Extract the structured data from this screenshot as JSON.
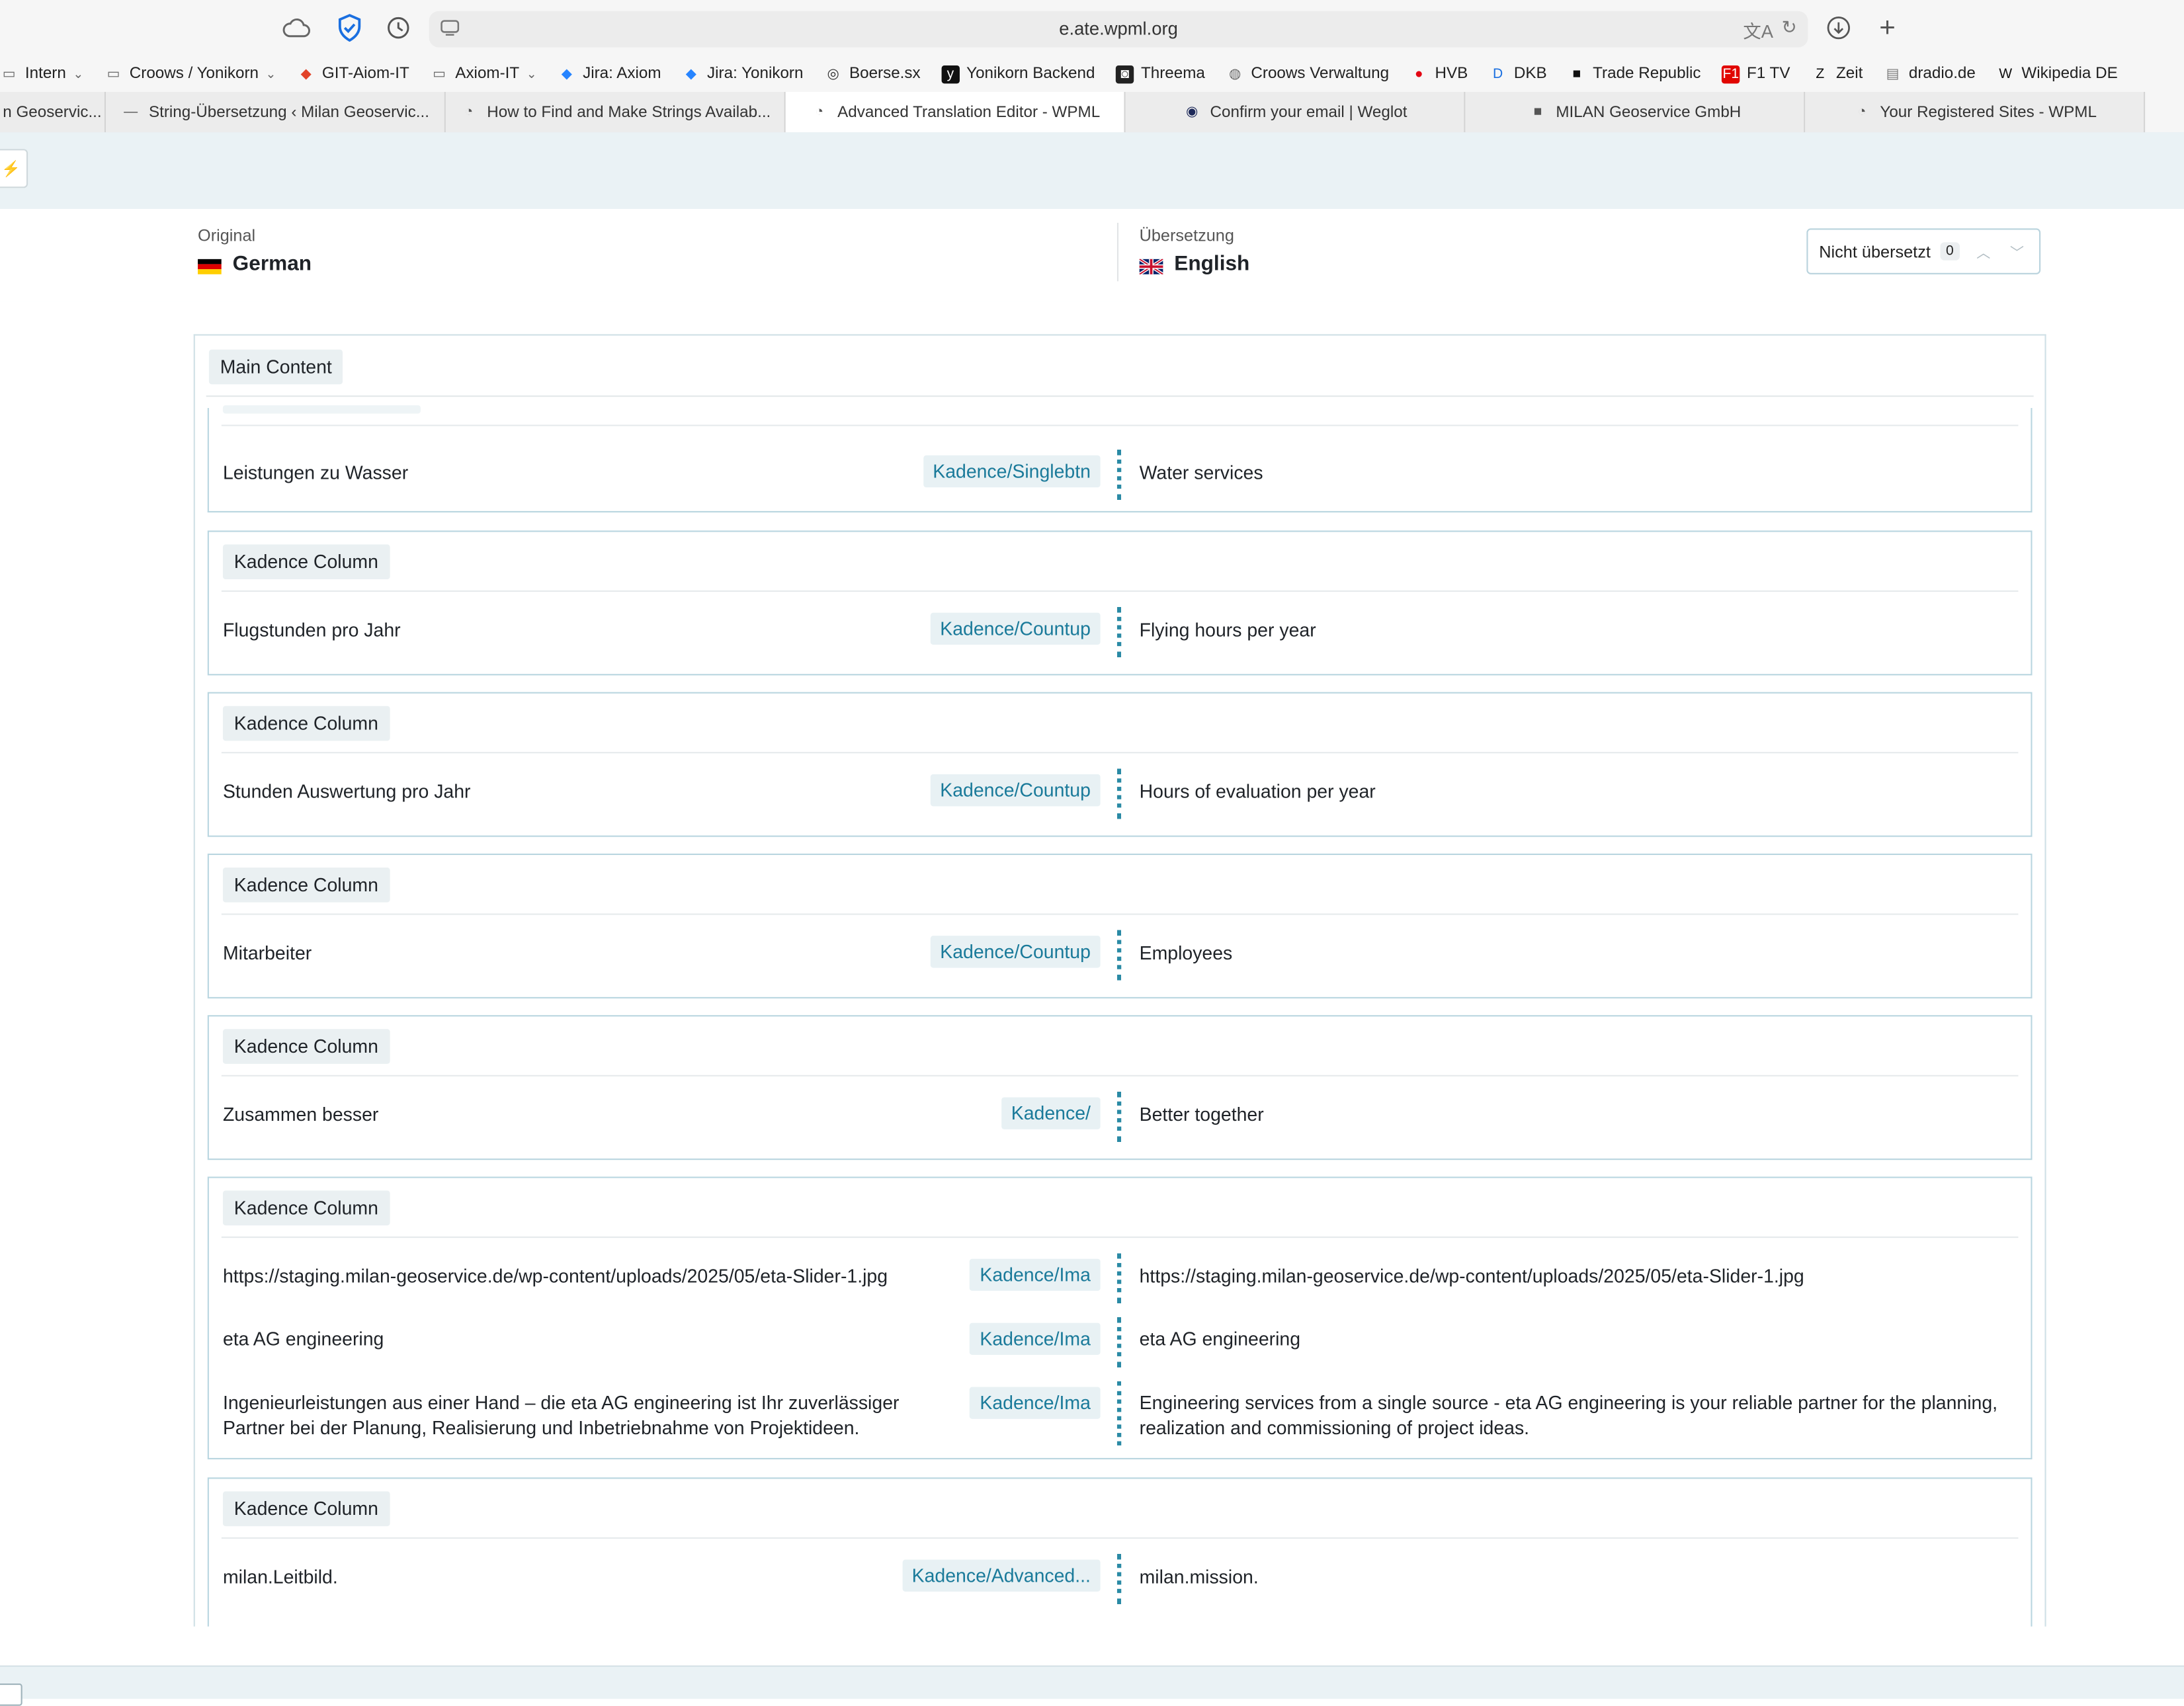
{
  "browser": {
    "url": "e.ate.wpml.org",
    "bookmarks": [
      {
        "label": "Intern",
        "icon": "folder-icon",
        "dropdown": true
      },
      {
        "label": "Croows / Yonikorn",
        "icon": "folder-icon",
        "dropdown": true
      },
      {
        "label": "GIT-Aiom-IT",
        "icon": "gitlab-icon",
        "dropdown": false
      },
      {
        "label": "Axiom-IT",
        "icon": "folder-icon",
        "dropdown": true
      },
      {
        "label": "Jira: Axiom",
        "icon": "jira-icon",
        "dropdown": false
      },
      {
        "label": "Jira: Yonikorn",
        "icon": "jira-icon",
        "dropdown": false
      },
      {
        "label": "Boerse.sx",
        "icon": "boerse-icon",
        "dropdown": false
      },
      {
        "label": "Yonikorn Backend",
        "icon": "yonikorn-icon",
        "dropdown": false
      },
      {
        "label": "Threema",
        "icon": "threema-icon",
        "dropdown": false
      },
      {
        "label": "Croows Verwaltung",
        "icon": "globe-icon",
        "dropdown": false
      },
      {
        "label": "HVB",
        "icon": "hvb-icon",
        "dropdown": false
      },
      {
        "label": "DKB",
        "icon": "dkb-icon",
        "dropdown": false
      },
      {
        "label": "Trade Republic",
        "icon": "trade-republic-icon",
        "dropdown": false
      },
      {
        "label": "F1 TV",
        "icon": "f1-icon",
        "dropdown": false
      },
      {
        "label": "Zeit",
        "icon": "zeit-icon",
        "dropdown": false
      },
      {
        "label": "dradio.de",
        "icon": "dradio-icon",
        "dropdown": false
      },
      {
        "label": "Wikipedia DE",
        "icon": "wikipedia-icon",
        "dropdown": false
      }
    ],
    "tabs": [
      {
        "label": "n Geoservic...",
        "active": false
      },
      {
        "label": "String-Übersetzung ‹ Milan Geoservic...",
        "active": false
      },
      {
        "label": "How to Find and Make Strings Availab...",
        "active": false
      },
      {
        "label": "Advanced Translation Editor - WPML",
        "active": true
      },
      {
        "label": "Confirm your email | Weglot",
        "active": false
      },
      {
        "label": "MILAN Geoservice GmbH",
        "active": false
      },
      {
        "label": "Your Registered Sites - WPML",
        "active": false
      }
    ]
  },
  "editor": {
    "original_label": "Original",
    "original_language": "German",
    "translation_label": "Übersetzung",
    "translation_language": "English",
    "filter_label": "Nicht übersetzt",
    "filter_count": "0"
  },
  "main_section_label": "Main Content",
  "colors": {
    "accent": "#1a7a9a",
    "dots": "#2a8aa5",
    "card_border": "#b9d6e0"
  },
  "sections": [
    {
      "label": "",
      "rows": [
        {
          "source": "Leistungen zu Wasser",
          "tag": "Kadence/Singlebtn",
          "target": "Water services"
        }
      ]
    },
    {
      "label": "Kadence Column",
      "rows": [
        {
          "source": "Flugstunden pro Jahr",
          "tag": "Kadence/Countup",
          "target": "Flying hours per year"
        }
      ]
    },
    {
      "label": "Kadence Column",
      "rows": [
        {
          "source": "Stunden Auswertung pro Jahr",
          "tag": "Kadence/Countup",
          "target": "Hours of evaluation per year"
        }
      ]
    },
    {
      "label": "Kadence Column",
      "rows": [
        {
          "source": "Mitarbeiter",
          "tag": "Kadence/Countup",
          "target": "Employees"
        }
      ]
    },
    {
      "label": "Kadence Column",
      "rows": [
        {
          "source": "Zusammen besser",
          "tag": "Kadence/",
          "target": "Better together"
        }
      ]
    },
    {
      "label": "Kadence Column",
      "rows": [
        {
          "source": "https://staging.milan-geoservice.de/wp-content/uploads/2025/05/eta-Slider-1.jpg",
          "tag": "Kadence/Ima",
          "target": "https://staging.milan-geoservice.de/wp-content/uploads/2025/05/eta-Slider-1.jpg"
        },
        {
          "source": "eta AG engineering",
          "tag": "Kadence/Ima",
          "target": "eta AG engineering"
        },
        {
          "source": "Ingenieurleistungen aus einer Hand – die eta AG engineering ist Ihr zuverlässiger Partner bei der Planung, Realisierung und Inbetriebnahme von Projektideen.",
          "tag": "Kadence/Ima",
          "target": "Engineering services from a single source - eta AG engineering is your reliable partner for the planning, realization and commissioning of project ideas."
        }
      ]
    },
    {
      "label": "Kadence Column",
      "rows": [
        {
          "source": "milan.Leitbild.",
          "tag": "Kadence/Advanced...",
          "target": "milan.mission."
        }
      ]
    }
  ]
}
